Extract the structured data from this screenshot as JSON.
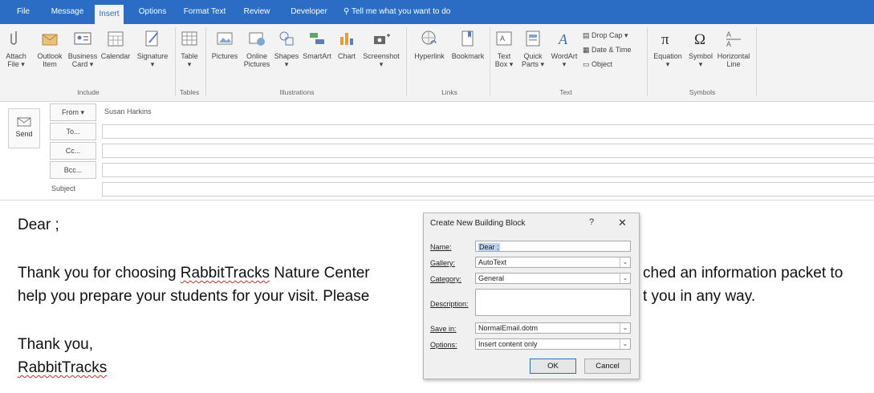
{
  "tabs": [
    "File",
    "Message",
    "Insert",
    "Options",
    "Format Text",
    "Review",
    "Developer"
  ],
  "active_tab": "Insert",
  "tell_me": "Tell me what you want to do",
  "ribbon": {
    "include": {
      "label": "Include",
      "buttons": [
        {
          "l1": "Attach",
          "l2": "File ▾"
        },
        {
          "l1": "Outlook",
          "l2": "Item"
        },
        {
          "l1": "Business",
          "l2": "Card ▾"
        },
        {
          "l1": "Calendar",
          "l2": ""
        },
        {
          "l1": "Signature",
          "l2": "▾"
        }
      ]
    },
    "tables": {
      "label": "Tables",
      "buttons": [
        {
          "l1": "Table",
          "l2": "▾"
        }
      ]
    },
    "illustrations": {
      "label": "Illustrations",
      "buttons": [
        {
          "l1": "Pictures",
          "l2": ""
        },
        {
          "l1": "Online",
          "l2": "Pictures"
        },
        {
          "l1": "Shapes",
          "l2": "▾"
        },
        {
          "l1": "SmartArt",
          "l2": ""
        },
        {
          "l1": "Chart",
          "l2": ""
        },
        {
          "l1": "Screenshot",
          "l2": "▾"
        }
      ]
    },
    "links": {
      "label": "Links",
      "buttons": [
        {
          "l1": "Hyperlink",
          "l2": ""
        },
        {
          "l1": "Bookmark",
          "l2": ""
        }
      ]
    },
    "text": {
      "label": "Text",
      "buttons": [
        {
          "l1": "Text",
          "l2": "Box ▾"
        },
        {
          "l1": "Quick",
          "l2": "Parts ▾"
        },
        {
          "l1": "WordArt",
          "l2": "▾"
        }
      ],
      "small": [
        "Drop Cap ▾",
        "Date & Time",
        "Object"
      ]
    },
    "symbols": {
      "label": "Symbols",
      "buttons": [
        {
          "l1": "Equation",
          "l2": "▾"
        },
        {
          "l1": "Symbol",
          "l2": "▾"
        },
        {
          "l1": "Horizontal",
          "l2": "Line"
        }
      ]
    }
  },
  "header": {
    "send_label": "Send",
    "from_btn": "From ▾",
    "from_value": "Susan Harkins",
    "to_btn": "To...",
    "cc_btn": "Cc...",
    "bcc_btn": "Bcc...",
    "subject_label": "Subject"
  },
  "body": {
    "line1": "Dear ;",
    "line2a": "Thank you for choosing ",
    "line2b": "RabbitTracks",
    "line2c": " Nature Center",
    "line2d": "ched an information packet to",
    "line3a": "help you prepare your students for your visit. Please",
    "line3b": "t you in any way.",
    "line4": "Thank you,",
    "line5": "RabbitTracks"
  },
  "dialog": {
    "title": "Create New Building Block",
    "help": "?",
    "close": "✕",
    "name_label": "Name:",
    "name_value": "Dear ;",
    "gallery_label": "Gallery:",
    "gallery_value": "AutoText",
    "category_label": "Category:",
    "category_value": "General",
    "description_label": "Description:",
    "description_value": "",
    "save_label": "Save in:",
    "save_value": "NormalEmail.dotm",
    "options_label": "Options:",
    "options_value": "Insert content only",
    "ok": "OK",
    "cancel": "Cancel"
  }
}
